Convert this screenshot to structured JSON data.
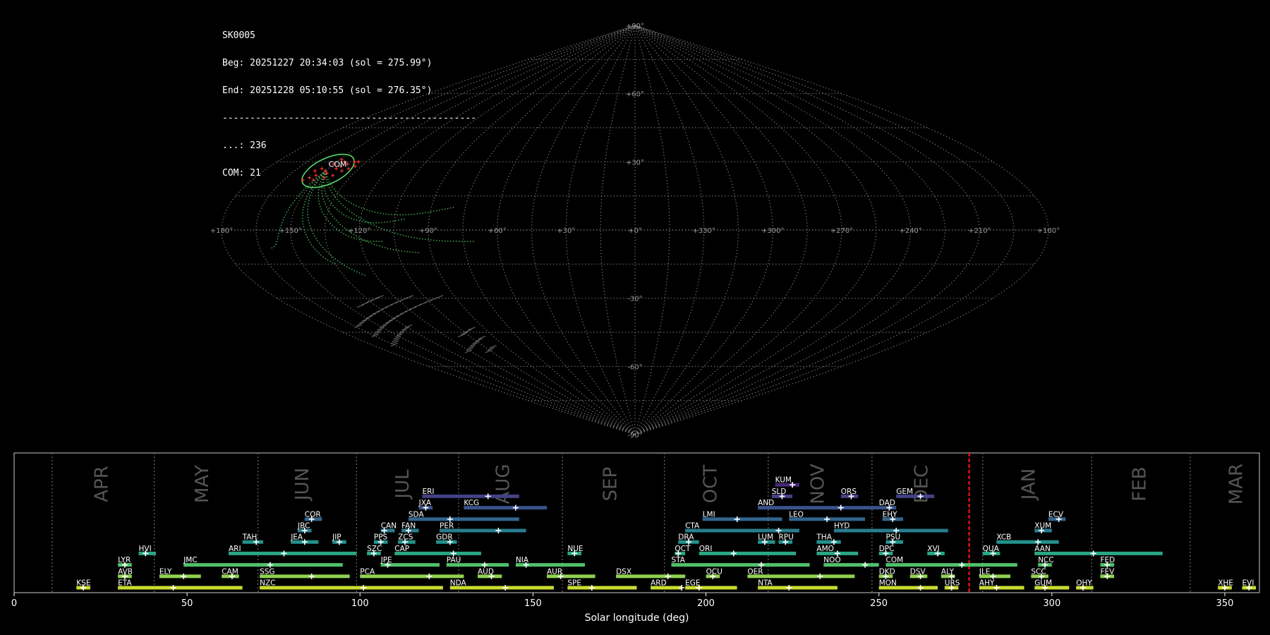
{
  "info": {
    "station": "SK0005",
    "beg": "Beg: 20251227 20:34:03 (sol = 275.99°)",
    "end": "End: 20251228 05:10:55 (sol = 276.35°)",
    "divider": "----------------------------------------------",
    "sporadic": "...: 236",
    "com": "COM: 21"
  },
  "colors": {
    "background": "#000000",
    "grid": "#777777",
    "radiant_track": "#55d66a",
    "radiant_points": "#e8352f",
    "current_sol": "#e01010",
    "frame": "#cccccc"
  },
  "chart_data": [
    {
      "type": "scatter",
      "projection": "sinusoidal",
      "lon_labels": [
        "+180°",
        "+150°",
        "+120°",
        "+90°",
        "+60°",
        "+30°",
        "+0°",
        "+330°",
        "+300°",
        "+270°",
        "+240°",
        "+210°",
        "+180°"
      ],
      "lat_labels": [
        "+90°",
        "+60°",
        "+30°",
        "-30°",
        "-60°",
        "-90°"
      ],
      "shower_label": "COM",
      "radiant_cluster": [
        {
          "lon": 150,
          "lat": 26
        },
        {
          "lon": 148,
          "lat": 25
        },
        {
          "lon": 146,
          "lat": 27
        },
        {
          "lon": 152,
          "lat": 24
        },
        {
          "lon": 145,
          "lat": 28
        },
        {
          "lon": 154,
          "lat": 23
        },
        {
          "lon": 143,
          "lat": 29
        },
        {
          "lon": 156,
          "lat": 22
        },
        {
          "lon": 141,
          "lat": 30
        },
        {
          "lon": 150,
          "lat": 29
        },
        {
          "lon": 147,
          "lat": 23
        },
        {
          "lon": 144,
          "lat": 24
        },
        {
          "lon": 153,
          "lat": 27
        },
        {
          "lon": 139,
          "lat": 30
        },
        {
          "lon": 142,
          "lat": 26
        },
        {
          "lon": 149,
          "lat": 31
        },
        {
          "lon": 155,
          "lat": 26
        },
        {
          "lon": 138,
          "lat": 28
        },
        {
          "lon": 146,
          "lat": 30
        },
        {
          "lon": 151,
          "lat": 22
        },
        {
          "lon": 140,
          "lat": 27
        }
      ]
    },
    {
      "type": "bar",
      "orientation": "horizontal",
      "xlabel": "Solar longitude (deg)",
      "xlim": [
        0,
        360
      ],
      "xticks": [
        0,
        50,
        100,
        150,
        200,
        250,
        300,
        350
      ],
      "current_sol": 276.1,
      "months": [
        {
          "name": "APR",
          "start": 11,
          "mid": 25
        },
        {
          "name": "MAY",
          "start": 40.5,
          "mid": 54
        },
        {
          "name": "JUN",
          "start": 70.5,
          "mid": 83
        },
        {
          "name": "JUL",
          "start": 99,
          "mid": 112
        },
        {
          "name": "AUG",
          "start": 128.5,
          "mid": 141
        },
        {
          "name": "SEP",
          "start": 158.5,
          "mid": 172
        },
        {
          "name": "OCT",
          "start": 188,
          "mid": 201
        },
        {
          "name": "NOV",
          "start": 218,
          "mid": 232
        },
        {
          "name": "DEC",
          "start": 248,
          "mid": 262
        },
        {
          "name": "JAN",
          "start": 280,
          "mid": 293
        },
        {
          "name": "FEB",
          "start": 311.5,
          "mid": 325
        },
        {
          "name": "MAR",
          "start": 340,
          "mid": 353
        }
      ],
      "showers": [
        {
          "code": "KUM",
          "start": 220,
          "end": 227,
          "peak": 225,
          "row": 9
        },
        {
          "code": "ERI",
          "start": 118,
          "end": 146,
          "peak": 137,
          "row": 8
        },
        {
          "code": "SLD",
          "start": 219,
          "end": 225,
          "peak": 222,
          "row": 8
        },
        {
          "code": "ORS",
          "start": 239,
          "end": 244,
          "peak": 242,
          "row": 8
        },
        {
          "code": "GEM",
          "start": 255,
          "end": 266,
          "peak": 262,
          "row": 8
        },
        {
          "code": "JXA",
          "start": 117,
          "end": 121,
          "peak": 119,
          "row": 7
        },
        {
          "code": "KCG",
          "start": 130,
          "end": 154,
          "peak": 145,
          "row": 7
        },
        {
          "code": "AND",
          "start": 215,
          "end": 250,
          "peak": 239,
          "row": 7
        },
        {
          "code": "DAD",
          "start": 250,
          "end": 255,
          "peak": 253,
          "row": 7
        },
        {
          "code": "COR",
          "start": 84,
          "end": 89,
          "peak": 86,
          "row": 6
        },
        {
          "code": "SDA",
          "start": 114,
          "end": 146,
          "peak": 126,
          "row": 6
        },
        {
          "code": "LMI",
          "start": 199,
          "end": 222,
          "peak": 209,
          "row": 6
        },
        {
          "code": "LEO",
          "start": 224,
          "end": 246,
          "peak": 235,
          "row": 6
        },
        {
          "code": "EHY",
          "start": 251,
          "end": 257,
          "peak": 254,
          "row": 6
        },
        {
          "code": "ECV",
          "start": 299,
          "end": 304,
          "peak": 302,
          "row": 6
        },
        {
          "code": "JBC",
          "start": 82,
          "end": 86,
          "peak": 84,
          "row": 5
        },
        {
          "code": "CAN",
          "start": 106,
          "end": 110,
          "peak": 107,
          "row": 5
        },
        {
          "code": "FAN",
          "start": 112,
          "end": 117,
          "peak": 114,
          "row": 5
        },
        {
          "code": "PER",
          "start": 123,
          "end": 148,
          "peak": 140,
          "row": 5
        },
        {
          "code": "CTA",
          "start": 194,
          "end": 227,
          "peak": 221,
          "row": 5
        },
        {
          "code": "HYD",
          "start": 237,
          "end": 270,
          "peak": 255,
          "row": 5
        },
        {
          "code": "XUM",
          "start": 295,
          "end": 300,
          "peak": 297,
          "row": 5
        },
        {
          "code": "TAH",
          "start": 66,
          "end": 72,
          "peak": 70,
          "row": 4
        },
        {
          "code": "JEA",
          "start": 80,
          "end": 88,
          "peak": 84,
          "row": 4
        },
        {
          "code": "JIP",
          "start": 92,
          "end": 96,
          "peak": 94,
          "row": 4
        },
        {
          "code": "PPS",
          "start": 104,
          "end": 108,
          "peak": 106,
          "row": 4
        },
        {
          "code": "ZCS",
          "start": 111,
          "end": 116,
          "peak": 113,
          "row": 4
        },
        {
          "code": "GDR",
          "start": 122,
          "end": 128,
          "peak": 126,
          "row": 4
        },
        {
          "code": "DRA",
          "start": 192,
          "end": 198,
          "peak": 195,
          "row": 4
        },
        {
          "code": "LUM",
          "start": 215,
          "end": 220,
          "peak": 217,
          "row": 4
        },
        {
          "code": "RPU",
          "start": 221,
          "end": 225,
          "peak": 223,
          "row": 4
        },
        {
          "code": "THA",
          "start": 232,
          "end": 239,
          "peak": 237,
          "row": 4
        },
        {
          "code": "PSU",
          "start": 252,
          "end": 257,
          "peak": 254,
          "row": 4
        },
        {
          "code": "XCB",
          "start": 284,
          "end": 302,
          "peak": 296,
          "row": 4
        },
        {
          "code": "HVI",
          "start": 36,
          "end": 41,
          "peak": 38,
          "row": 3
        },
        {
          "code": "ARI",
          "start": 62,
          "end": 99,
          "peak": 78,
          "row": 3
        },
        {
          "code": "SZC",
          "start": 102,
          "end": 106,
          "peak": 104,
          "row": 3
        },
        {
          "code": "CAP",
          "start": 110,
          "end": 135,
          "peak": 127,
          "row": 3
        },
        {
          "code": "NUE",
          "start": 160,
          "end": 164,
          "peak": 162,
          "row": 3
        },
        {
          "code": "OCT",
          "start": 191,
          "end": 194,
          "peak": 192,
          "row": 3
        },
        {
          "code": "ORI",
          "start": 198,
          "end": 226,
          "peak": 208,
          "row": 3
        },
        {
          "code": "AMO",
          "start": 232,
          "end": 244,
          "peak": 238,
          "row": 3
        },
        {
          "code": "DPC",
          "start": 250,
          "end": 254,
          "peak": 252,
          "row": 3
        },
        {
          "code": "XVI",
          "start": 264,
          "end": 269,
          "peak": 267,
          "row": 3
        },
        {
          "code": "QUA",
          "start": 280,
          "end": 285,
          "peak": 283,
          "row": 3
        },
        {
          "code": "AAN",
          "start": 295,
          "end": 332,
          "peak": 312,
          "row": 3
        },
        {
          "code": "LYR",
          "start": 30,
          "end": 34,
          "peak": 32,
          "row": 2
        },
        {
          "code": "JMC",
          "start": 49,
          "end": 95,
          "peak": 74,
          "row": 2
        },
        {
          "code": "JPE",
          "start": 106,
          "end": 123,
          "peak": 108,
          "row": 2
        },
        {
          "code": "PAU",
          "start": 125,
          "end": 143,
          "peak": 136,
          "row": 2
        },
        {
          "code": "NIA",
          "start": 145,
          "end": 165,
          "peak": 148,
          "row": 2
        },
        {
          "code": "STA",
          "start": 190,
          "end": 230,
          "peak": 216,
          "row": 2
        },
        {
          "code": "NOO",
          "start": 234,
          "end": 250,
          "peak": 246,
          "row": 2
        },
        {
          "code": "COM",
          "start": 252,
          "end": 290,
          "peak": 274,
          "row": 2
        },
        {
          "code": "NCC",
          "start": 296,
          "end": 300,
          "peak": 298,
          "row": 2
        },
        {
          "code": "FED",
          "start": 314,
          "end": 318,
          "peak": 316,
          "row": 2
        },
        {
          "code": "AVB",
          "start": 30,
          "end": 34,
          "peak": 32,
          "row": 1
        },
        {
          "code": "ELY",
          "start": 42,
          "end": 54,
          "peak": 49,
          "row": 1
        },
        {
          "code": "CAM",
          "start": 60,
          "end": 65,
          "peak": 63,
          "row": 1
        },
        {
          "code": "SSG",
          "start": 71,
          "end": 97,
          "peak": 86,
          "row": 1
        },
        {
          "code": "PCA",
          "start": 100,
          "end": 130,
          "peak": 120,
          "row": 1
        },
        {
          "code": "AUD",
          "start": 134,
          "end": 141,
          "peak": 138,
          "row": 1
        },
        {
          "code": "AUR",
          "start": 154,
          "end": 168,
          "peak": 158,
          "row": 1
        },
        {
          "code": "DSX",
          "start": 174,
          "end": 194,
          "peak": 189,
          "row": 1
        },
        {
          "code": "OCU",
          "start": 200,
          "end": 204,
          "peak": 202,
          "row": 1
        },
        {
          "code": "OER",
          "start": 212,
          "end": 243,
          "peak": 233,
          "row": 1
        },
        {
          "code": "DKD",
          "start": 250,
          "end": 254,
          "peak": 252,
          "row": 1
        },
        {
          "code": "DSV",
          "start": 259,
          "end": 264,
          "peak": 262,
          "row": 1
        },
        {
          "code": "ALY",
          "start": 268,
          "end": 272,
          "peak": 271,
          "row": 1
        },
        {
          "code": "JLE",
          "start": 279,
          "end": 288,
          "peak": 283,
          "row": 1
        },
        {
          "code": "SCC",
          "start": 294,
          "end": 299,
          "peak": 297,
          "row": 1
        },
        {
          "code": "FEV",
          "start": 314,
          "end": 318,
          "peak": 316,
          "row": 1
        },
        {
          "code": "KSE",
          "start": 18,
          "end": 22,
          "peak": 20,
          "row": 0
        },
        {
          "code": "ETA",
          "start": 30,
          "end": 66,
          "peak": 46,
          "row": 0
        },
        {
          "code": "NZC",
          "start": 71,
          "end": 124,
          "peak": 101,
          "row": 0
        },
        {
          "code": "NDA",
          "start": 126,
          "end": 156,
          "peak": 142,
          "row": 0
        },
        {
          "code": "SPE",
          "start": 160,
          "end": 180,
          "peak": 167,
          "row": 0
        },
        {
          "code": "ARD",
          "start": 184,
          "end": 193,
          "peak": 193,
          "row": 0
        },
        {
          "code": "EGE",
          "start": 194,
          "end": 209,
          "peak": 198,
          "row": 0
        },
        {
          "code": "NTA",
          "start": 215,
          "end": 238,
          "peak": 224,
          "row": 0
        },
        {
          "code": "MON",
          "start": 250,
          "end": 267,
          "peak": 262,
          "row": 0
        },
        {
          "code": "URS",
          "start": 269,
          "end": 273,
          "peak": 271,
          "row": 0
        },
        {
          "code": "AHY",
          "start": 279,
          "end": 292,
          "peak": 284,
          "row": 0
        },
        {
          "code": "GUM",
          "start": 295,
          "end": 305,
          "peak": 298,
          "row": 0
        },
        {
          "code": "OHY",
          "start": 307,
          "end": 312,
          "peak": 309,
          "row": 0
        },
        {
          "code": "XHE",
          "start": 348,
          "end": 352,
          "peak": 350,
          "row": 0
        },
        {
          "code": "EVI",
          "start": 355,
          "end": 359,
          "peak": 357,
          "row": 0
        }
      ]
    }
  ]
}
